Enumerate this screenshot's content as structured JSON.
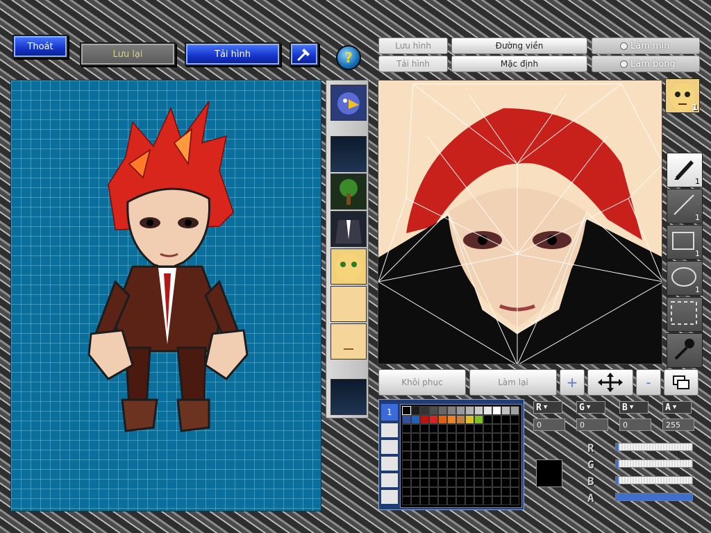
{
  "toolbar": {
    "exit_label": "Thoát",
    "save_label": "Lưu lại",
    "reload_label": "Tải hình",
    "help_symbol": "?"
  },
  "editor_header": {
    "save_image_label": "Lưu hình",
    "load_image_label": "Tải hình",
    "outline_label": "Đường viền",
    "default_label": "Mặc định",
    "smooth_label": "Làm mịn",
    "shine_label": "Làm bóng"
  },
  "part_list": {
    "slots": [
      {
        "icon": "bird-mask-icon",
        "empty": false
      },
      {
        "icon": "",
        "empty": true
      },
      {
        "icon": "tree-icon",
        "empty": false
      },
      {
        "icon": "suit-icon",
        "empty": false
      },
      {
        "icon": "face-yellow-icon",
        "empty": false
      },
      {
        "icon": "face-blank-icon",
        "empty": false
      },
      {
        "icon": "face-blank-mouth-icon",
        "empty": false
      },
      {
        "icon": "",
        "empty": true
      }
    ]
  },
  "tools": [
    {
      "name": "pen",
      "count": "1",
      "active": true
    },
    {
      "name": "line",
      "count": "1",
      "active": false
    },
    {
      "name": "rectangle",
      "count": "1",
      "active": false
    },
    {
      "name": "ellipse",
      "count": "1",
      "active": false
    },
    {
      "name": "select",
      "count": "",
      "active": false
    },
    {
      "name": "eyedropper",
      "count": "",
      "active": false
    }
  ],
  "avatar_badge": "1",
  "actions": {
    "restore_label": "Khôi phục",
    "redo_label": "Làm lại",
    "zoom_in": "+",
    "zoom_out": "-"
  },
  "palette": {
    "tab_label": "1",
    "colors": [
      "#000000",
      "#1a1a1a",
      "#333333",
      "#4d4d4d",
      "#666666",
      "#808080",
      "#999999",
      "#b3b3b3",
      "#cccccc",
      "#e6e6e6",
      "#ffffff",
      "#c0c0c0",
      "#a0a0a0",
      "#3050a0",
      "#2060c0",
      "#c01010",
      "#e02020",
      "#e06010",
      "#f08020",
      "#c08040",
      "#e0c020",
      "#80c020"
    ]
  },
  "color_channels": {
    "r_tag": "R",
    "g_tag": "G",
    "b_tag": "B",
    "a_tag": "A",
    "r_value": "0",
    "g_value": "0",
    "b_value": "0",
    "a_value": "255",
    "r_level": 0,
    "g_level": 0,
    "b_level": 0,
    "a_level": 1,
    "current_color": "#000000"
  },
  "colors": {
    "canvas_bg": "#0a6f9c",
    "skin": "#f7dfc0",
    "hair": "#d9261c",
    "accent_blue": "#1433c8"
  }
}
